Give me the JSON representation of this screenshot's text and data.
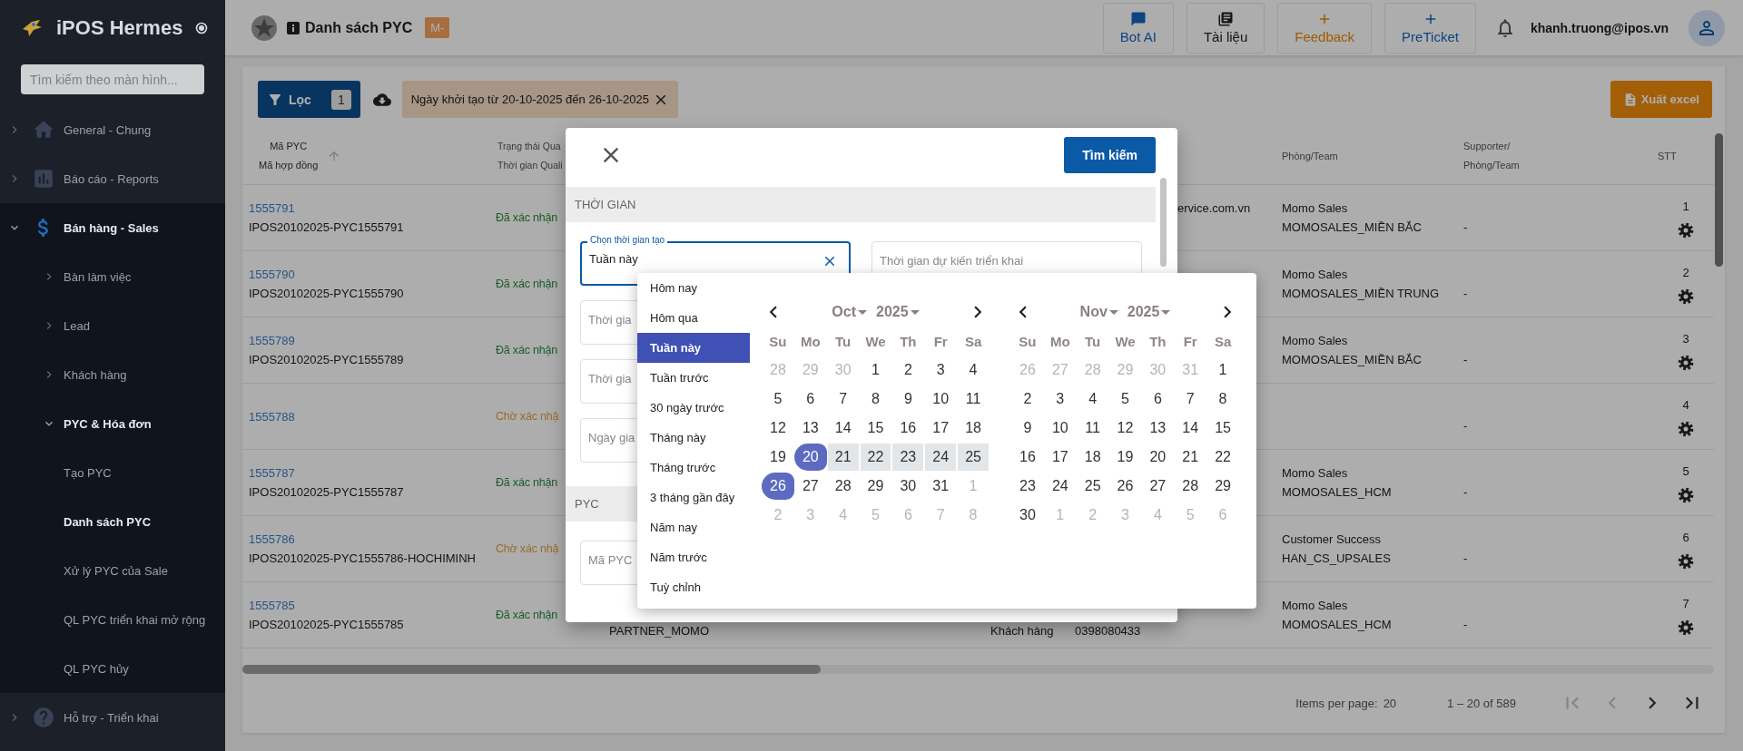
{
  "sidebar": {
    "title": "iPOS Hermes",
    "search_placeholder": "Tìm kiếm theo màn hình...",
    "items": [
      {
        "label": "General - Chung",
        "expanded": false
      },
      {
        "label": "Báo cáo - Reports",
        "expanded": false
      },
      {
        "label": "Bán hàng - Sales",
        "expanded": true,
        "children": [
          {
            "label": "Bàn làm việc",
            "expanded": false
          },
          {
            "label": "Lead",
            "expanded": false
          },
          {
            "label": "Khách hàng",
            "expanded": false
          },
          {
            "label": "PYC & Hóa đơn",
            "expanded": true,
            "children": [
              {
                "label": "Tạo PYC",
                "selected": false
              },
              {
                "label": "Danh sách PYC",
                "selected": true
              },
              {
                "label": "Xử lý PYC của Sale",
                "selected": false
              },
              {
                "label": "QL PYC triển khai mở rộng",
                "selected": false
              },
              {
                "label": "QL PYC hủy",
                "selected": false
              }
            ]
          }
        ]
      },
      {
        "label": "Hỗ trợ - Triển khai",
        "expanded": false
      }
    ]
  },
  "header": {
    "title": "Danh sách PYC",
    "badge": "M-",
    "buttons": [
      {
        "label": "Bot AI",
        "kind": "chat"
      },
      {
        "label": "Tài liệu",
        "kind": "book"
      },
      {
        "label": "Feedback",
        "kind": "plus-accent"
      },
      {
        "label": "PreTicket",
        "kind": "plus"
      }
    ],
    "user": "khanh.truong@ipos.vn"
  },
  "toolbar": {
    "filter_label": "Lọc",
    "filter_count": "1",
    "chip": "Ngày khởi tạo từ 20-10-2025 đến 26-10-2025",
    "export_label": "Xuất excel"
  },
  "table": {
    "columns": [
      {
        "lines": [
          "Mã PYC",
          "Mã hợp đồng"
        ],
        "sorted": true
      },
      {
        "lines": [
          "Trạng thái Qua",
          "Thời gian Quali"
        ],
        "sorted": false
      },
      {
        "lines": [
          "Phòng/Team"
        ],
        "sorted": false
      },
      {
        "lines": [
          "Supporter/",
          "Phòng/Team"
        ],
        "sorted": false
      },
      {
        "lines": [
          "STT"
        ],
        "sorted": false
      }
    ],
    "rows": [
      {
        "id": "1555791",
        "contract": "IPOS20102025-PYC1555791",
        "status": "Đã xác nhận",
        "confirmed": true,
        "email": "ervice.com.vn",
        "team": "Momo Sales",
        "team_code": "MOMOSALES_MIỀN BẮC",
        "supporter": "-",
        "stt": "1"
      },
      {
        "id": "1555790",
        "contract": "IPOS20102025-PYC1555790",
        "status": "Đã xác nhận",
        "confirmed": true,
        "team": "Momo Sales",
        "team_code": "MOMOSALES_MIỀN TRUNG",
        "supporter": "-",
        "stt": "2"
      },
      {
        "id": "1555789",
        "contract": "IPOS20102025-PYC1555789",
        "status": "Đã xác nhận",
        "confirmed": true,
        "team": "Momo Sales",
        "team_code": "MOMOSALES_MIỀN BẮC",
        "supporter": "-",
        "stt": "3"
      },
      {
        "id": "1555788",
        "status": "Chờ xác nhậ",
        "confirmed": false,
        "supporter": "-",
        "stt": "4"
      },
      {
        "id": "1555787",
        "contract": "IPOS20102025-PYC1555787",
        "status": "Đã xác nhận",
        "confirmed": true,
        "team": "Momo Sales",
        "team_code": "MOMOSALES_HCM",
        "supporter": "-",
        "stt": "5"
      },
      {
        "id": "1555786",
        "contract": "IPOS20102025-PYC1555786-HOCHIMINH",
        "status": "Chờ xác nhậ",
        "confirmed": false,
        "team": "Customer Success",
        "team_code": "HAN_CS_UPSALES",
        "supporter": "-",
        "stt": "6"
      },
      {
        "id": "1555785",
        "contract": "IPOS20102025-PYC1555785",
        "status": "Đã xác nhận",
        "confirmed": true,
        "partner": "PARTNER_MOMO",
        "customer_type": "Khách hàng",
        "phone": "0398080433",
        "team": "Momo Sales",
        "team_code": "MOMOSALES_HCM",
        "supporter": "-",
        "stt": "7"
      }
    ]
  },
  "pagination": {
    "items_per_page_label": "Items per page:",
    "items_per_page": "20",
    "range": "1 – 20 of 589",
    "nav": [
      {
        "kind": "first",
        "disabled": true
      },
      {
        "kind": "prev",
        "disabled": true
      },
      {
        "kind": "next",
        "disabled": false
      },
      {
        "kind": "last",
        "disabled": false
      }
    ]
  },
  "filter_dialog": {
    "search_button": "Tìm kiếm",
    "sections": [
      {
        "title": "THỜI GIAN",
        "rows": [
          [
            {
              "label": "Chọn thời gian tạo",
              "value": "Tuần này",
              "focused": true
            },
            {
              "placeholder": "Thời gian dự kiến triển khai",
              "focused": false
            }
          ],
          [
            {
              "placeholder": "Thời gia",
              "focused": false
            }
          ],
          [
            {
              "placeholder": "Thời gia",
              "focused": false
            }
          ],
          [
            {
              "placeholder": "Ngày gia",
              "focused": false
            }
          ]
        ]
      },
      {
        "title": "PYC",
        "rows": [
          [
            {
              "placeholder": "Mã PYC",
              "focused": false
            }
          ]
        ]
      }
    ]
  },
  "date_picker": {
    "presets": [
      {
        "label": "Hôm nay",
        "selected": false
      },
      {
        "label": "Hôm qua",
        "selected": false
      },
      {
        "label": "Tuần này",
        "selected": true
      },
      {
        "label": "Tuần trước",
        "selected": false
      },
      {
        "label": "30 ngày trước",
        "selected": false
      },
      {
        "label": "Tháng này",
        "selected": false
      },
      {
        "label": "Tháng trước",
        "selected": false
      },
      {
        "label": "3 tháng gần đây",
        "selected": false
      },
      {
        "label": "Năm nay",
        "selected": false
      },
      {
        "label": "Năm trước",
        "selected": false
      },
      {
        "label": "Tuỳ chỉnh",
        "selected": false
      }
    ],
    "months": [
      {
        "month": "Oct",
        "year": "2025",
        "weekdays": [
          "Su",
          "Mo",
          "Tu",
          "We",
          "Th",
          "Fr",
          "Sa"
        ],
        "weeks": [
          [
            {
              "d": "28",
              "outside": true,
              "selected": false,
              "in_range": false
            },
            {
              "d": "29",
              "outside": true,
              "selected": false,
              "in_range": false
            },
            {
              "d": "30",
              "outside": true,
              "selected": false,
              "in_range": false
            },
            {
              "d": "1",
              "outside": false,
              "selected": false,
              "in_range": false
            },
            {
              "d": "2",
              "outside": false,
              "selected": false,
              "in_range": false
            },
            {
              "d": "3",
              "outside": false,
              "selected": false,
              "in_range": false
            },
            {
              "d": "4",
              "outside": false,
              "selected": false,
              "in_range": false
            }
          ],
          [
            {
              "d": "5",
              "outside": false,
              "selected": false,
              "in_range": false
            },
            {
              "d": "6",
              "outside": false,
              "selected": false,
              "in_range": false
            },
            {
              "d": "7",
              "outside": false,
              "selected": false,
              "in_range": false
            },
            {
              "d": "8",
              "outside": false,
              "selected": false,
              "in_range": false
            },
            {
              "d": "9",
              "outside": false,
              "selected": false,
              "in_range": false
            },
            {
              "d": "10",
              "outside": false,
              "selected": false,
              "in_range": false
            },
            {
              "d": "11",
              "outside": false,
              "selected": false,
              "in_range": false
            }
          ],
          [
            {
              "d": "12",
              "outside": false,
              "selected": false,
              "in_range": false
            },
            {
              "d": "13",
              "outside": false,
              "selected": false,
              "in_range": false
            },
            {
              "d": "14",
              "outside": false,
              "selected": false,
              "in_range": false
            },
            {
              "d": "15",
              "outside": false,
              "selected": false,
              "in_range": false
            },
            {
              "d": "16",
              "outside": false,
              "selected": false,
              "in_range": false
            },
            {
              "d": "17",
              "outside": false,
              "selected": false,
              "in_range": false
            },
            {
              "d": "18",
              "outside": false,
              "selected": false,
              "in_range": false
            }
          ],
          [
            {
              "d": "19",
              "outside": false,
              "selected": false,
              "in_range": false
            },
            {
              "d": "20",
              "outside": false,
              "selected": true,
              "in_range": false
            },
            {
              "d": "21",
              "outside": false,
              "selected": false,
              "in_range": true
            },
            {
              "d": "22",
              "outside": false,
              "selected": false,
              "in_range": true
            },
            {
              "d": "23",
              "outside": false,
              "selected": false,
              "in_range": true
            },
            {
              "d": "24",
              "outside": false,
              "selected": false,
              "in_range": true
            },
            {
              "d": "25",
              "outside": false,
              "selected": false,
              "in_range": true
            }
          ],
          [
            {
              "d": "26",
              "outside": false,
              "selected": true,
              "in_range": false
            },
            {
              "d": "27",
              "outside": false,
              "selected": false,
              "in_range": false
            },
            {
              "d": "28",
              "outside": false,
              "selected": false,
              "in_range": false
            },
            {
              "d": "29",
              "outside": false,
              "selected": false,
              "in_range": false
            },
            {
              "d": "30",
              "outside": false,
              "selected": false,
              "in_range": false
            },
            {
              "d": "31",
              "outside": false,
              "selected": false,
              "in_range": false
            },
            {
              "d": "1",
              "outside": true,
              "selected": false,
              "in_range": false
            }
          ],
          [
            {
              "d": "2",
              "outside": true,
              "selected": false,
              "in_range": false
            },
            {
              "d": "3",
              "outside": true,
              "selected": false,
              "in_range": false
            },
            {
              "d": "4",
              "outside": true,
              "selected": false,
              "in_range": false
            },
            {
              "d": "5",
              "outside": true,
              "selected": false,
              "in_range": false
            },
            {
              "d": "6",
              "outside": true,
              "selected": false,
              "in_range": false
            },
            {
              "d": "7",
              "outside": true,
              "selected": false,
              "in_range": false
            },
            {
              "d": "8",
              "outside": true,
              "selected": false,
              "in_range": false
            }
          ]
        ]
      },
      {
        "month": "Nov",
        "year": "2025",
        "weekdays": [
          "Su",
          "Mo",
          "Tu",
          "We",
          "Th",
          "Fr",
          "Sa"
        ],
        "weeks": [
          [
            {
              "d": "26",
              "outside": true,
              "selected": false,
              "in_range": false
            },
            {
              "d": "27",
              "outside": true,
              "selected": false,
              "in_range": false
            },
            {
              "d": "28",
              "outside": true,
              "selected": false,
              "in_range": false
            },
            {
              "d": "29",
              "outside": true,
              "selected": false,
              "in_range": false
            },
            {
              "d": "30",
              "outside": true,
              "selected": false,
              "in_range": false
            },
            {
              "d": "31",
              "outside": true,
              "selected": false,
              "in_range": false
            },
            {
              "d": "1",
              "outside": false,
              "selected": false,
              "in_range": false
            }
          ],
          [
            {
              "d": "2",
              "outside": false,
              "selected": false,
              "in_range": false
            },
            {
              "d": "3",
              "outside": false,
              "selected": false,
              "in_range": false
            },
            {
              "d": "4",
              "outside": false,
              "selected": false,
              "in_range": false
            },
            {
              "d": "5",
              "outside": false,
              "selected": false,
              "in_range": false
            },
            {
              "d": "6",
              "outside": false,
              "selected": false,
              "in_range": false
            },
            {
              "d": "7",
              "outside": false,
              "selected": false,
              "in_range": false
            },
            {
              "d": "8",
              "outside": false,
              "selected": false,
              "in_range": false
            }
          ],
          [
            {
              "d": "9",
              "outside": false,
              "selected": false,
              "in_range": false
            },
            {
              "d": "10",
              "outside": false,
              "selected": false,
              "in_range": false
            },
            {
              "d": "11",
              "outside": false,
              "selected": false,
              "in_range": false
            },
            {
              "d": "12",
              "outside": false,
              "selected": false,
              "in_range": false
            },
            {
              "d": "13",
              "outside": false,
              "selected": false,
              "in_range": false
            },
            {
              "d": "14",
              "outside": false,
              "selected": false,
              "in_range": false
            },
            {
              "d": "15",
              "outside": false,
              "selected": false,
              "in_range": false
            }
          ],
          [
            {
              "d": "16",
              "outside": false,
              "selected": false,
              "in_range": false
            },
            {
              "d": "17",
              "outside": false,
              "selected": false,
              "in_range": false
            },
            {
              "d": "18",
              "outside": false,
              "selected": false,
              "in_range": false
            },
            {
              "d": "19",
              "outside": false,
              "selected": false,
              "in_range": false
            },
            {
              "d": "20",
              "outside": false,
              "selected": false,
              "in_range": false
            },
            {
              "d": "21",
              "outside": false,
              "selected": false,
              "in_range": false
            },
            {
              "d": "22",
              "outside": false,
              "selected": false,
              "in_range": false
            }
          ],
          [
            {
              "d": "23",
              "outside": false,
              "selected": false,
              "in_range": false
            },
            {
              "d": "24",
              "outside": false,
              "selected": false,
              "in_range": false
            },
            {
              "d": "25",
              "outside": false,
              "selected": false,
              "in_range": false
            },
            {
              "d": "26",
              "outside": false,
              "selected": false,
              "in_range": false
            },
            {
              "d": "27",
              "outside": false,
              "selected": false,
              "in_range": false
            },
            {
              "d": "28",
              "outside": false,
              "selected": false,
              "in_range": false
            },
            {
              "d": "29",
              "outside": false,
              "selected": false,
              "in_range": false
            }
          ],
          [
            {
              "d": "30",
              "outside": false,
              "selected": false,
              "in_range": false
            },
            {
              "d": "1",
              "outside": true,
              "selected": false,
              "in_range": false
            },
            {
              "d": "2",
              "outside": true,
              "selected": false,
              "in_range": false
            },
            {
              "d": "3",
              "outside": true,
              "selected": false,
              "in_range": false
            },
            {
              "d": "4",
              "outside": true,
              "selected": false,
              "in_range": false
            },
            {
              "d": "5",
              "outside": true,
              "selected": false,
              "in_range": false
            },
            {
              "d": "6",
              "outside": true,
              "selected": false,
              "in_range": false
            }
          ]
        ]
      }
    ]
  }
}
